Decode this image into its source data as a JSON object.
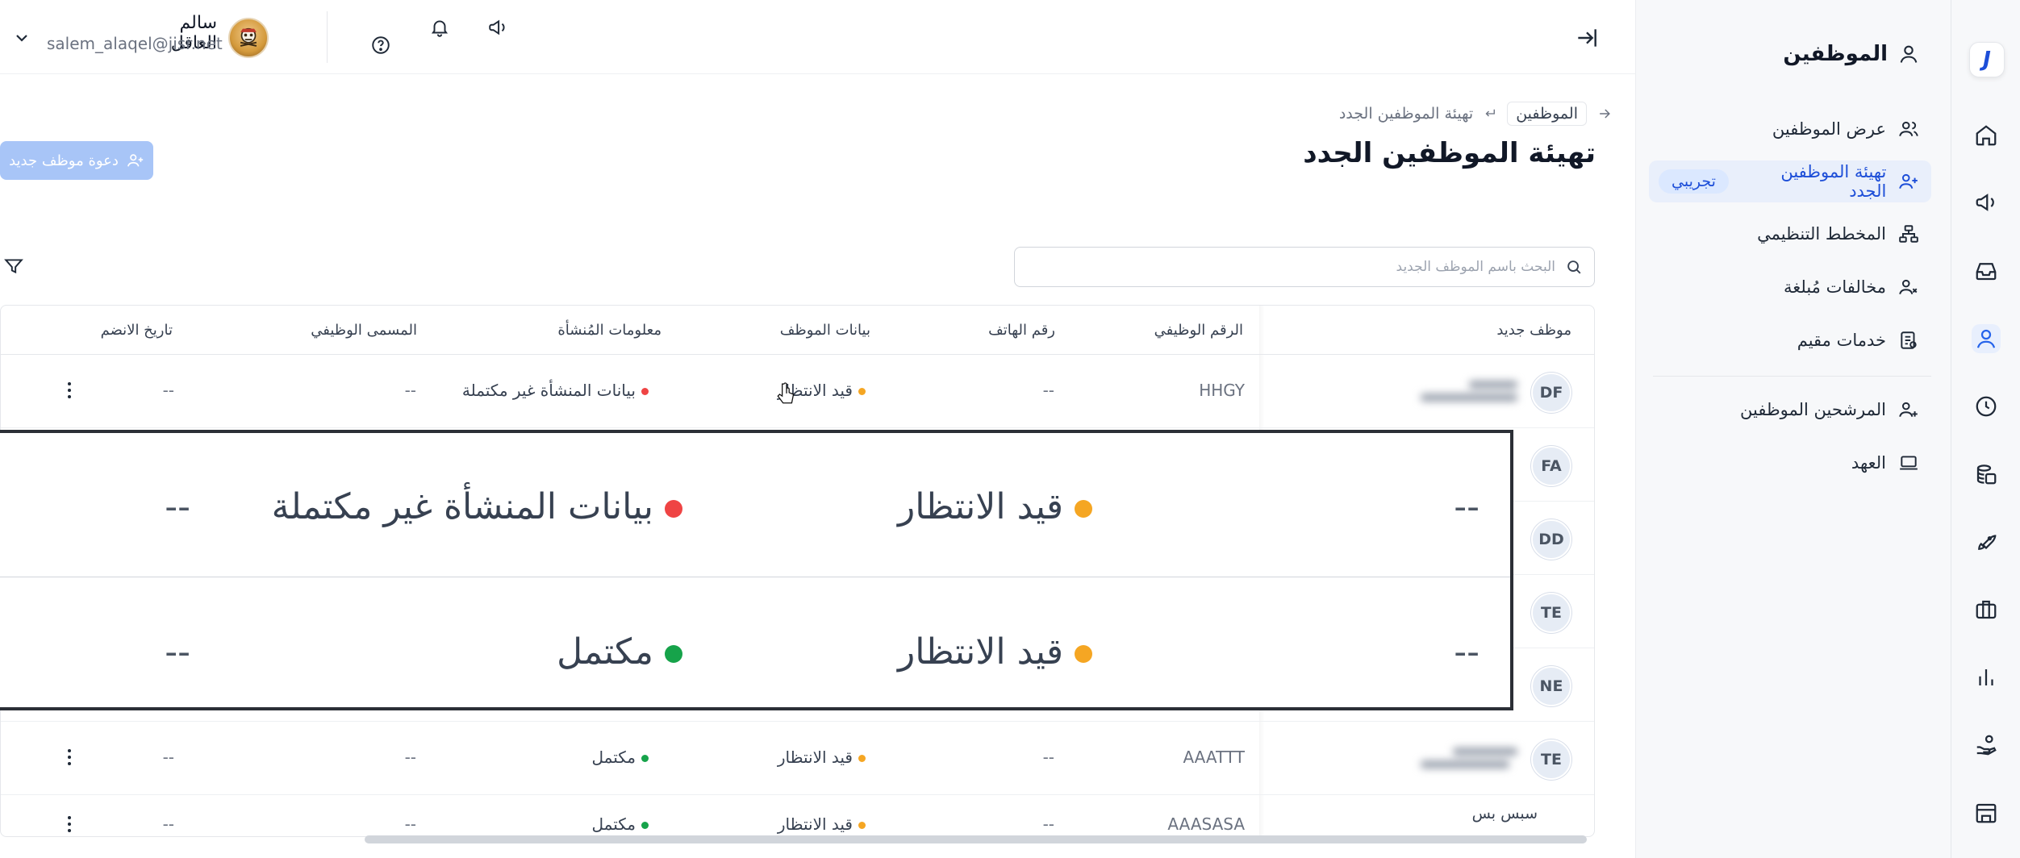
{
  "rail": {
    "icons": [
      "logo-icon",
      "home-icon",
      "megaphone-icon",
      "inbox-icon",
      "employees-icon",
      "clock-icon",
      "coins-icon",
      "rocket-icon",
      "briefcase-icon",
      "chart-icon",
      "hand-coin-icon",
      "building-icon"
    ],
    "logo_letter": "J",
    "accent": "#2563eb"
  },
  "side": {
    "title": "الموظفين",
    "items": [
      {
        "label": "عرض الموظفين",
        "icon": "users-icon"
      },
      {
        "label": "تهيئة الموظفين الجدد",
        "icon": "user-plus-icon",
        "badge": "تجريبي",
        "active": true
      },
      {
        "label": "المخطط التنظيمي",
        "icon": "org-chart-icon"
      },
      {
        "label": "مخالفات مُبلغة",
        "icon": "user-x-icon"
      },
      {
        "label": "خدمات مقيم",
        "icon": "document-icon"
      },
      {
        "label": "المرشحين الموظفين",
        "icon": "user-add-icon"
      },
      {
        "label": "العهد",
        "icon": "laptop-icon"
      }
    ]
  },
  "topbar": {
    "user_name": "سالم العاقل",
    "user_email": "salem_alaqel@jisr.net"
  },
  "header": {
    "breadcrumb_root": "الموظفين",
    "breadcrumb_current": "تهيئة الموظفين الجدد",
    "title": "تهيئة الموظفين الجدد",
    "invite_label": "دعوة موظف جديد"
  },
  "search": {
    "placeholder": "البحث باسم الموظف الجديد"
  },
  "table": {
    "columns": {
      "new_employee": "موظف جديد",
      "employee_id": "الرقم الوظيفي",
      "phone": "رقم الهاتف",
      "employee_data": "بيانات الموظف",
      "establishment_info": "معلومات المُنشأة",
      "job_title": "المسمى الوظيفي",
      "join_date": "تاريخ الانضم"
    },
    "rows": [
      {
        "initials": "DF",
        "employee_id": "HHGY",
        "phone": "--",
        "employee_status": "قيد الانتظار",
        "est_status": "بيانات المنشأة غير مكتملة",
        "est_color": "#ef4444",
        "job_title": "--",
        "join_date": "--"
      },
      {
        "initials": "FA",
        "employee_id": "",
        "phone": "",
        "employee_status": "",
        "est_status": "",
        "est_color": "",
        "job_title": "",
        "join_date": ""
      },
      {
        "initials": "DD",
        "employee_id": "",
        "phone": "",
        "employee_status": "",
        "est_status": "",
        "est_color": "",
        "job_title": "",
        "join_date": ""
      },
      {
        "initials": "TE",
        "employee_id": "",
        "phone": "",
        "employee_status": "",
        "est_status": "",
        "est_color": "",
        "job_title": "",
        "join_date": ""
      },
      {
        "initials": "NE",
        "employee_id": "",
        "phone": "",
        "employee_status": "",
        "est_status": "",
        "est_color": "",
        "job_title": "",
        "join_date": ""
      },
      {
        "initials": "TE",
        "employee_id": "AAATTT",
        "phone": "--",
        "employee_status": "قيد الانتظار",
        "est_status": "مكتمل",
        "est_color": "#16a34a",
        "job_title": "--",
        "join_date": "--"
      },
      {
        "initials": "",
        "name": "سبس بس",
        "employee_id": "AAASASA",
        "phone": "--",
        "employee_status": "قيد الانتظار",
        "est_status": "مكتمل",
        "est_color": "#16a34a",
        "job_title": "--",
        "join_date": "--"
      }
    ],
    "pending_color": "#f5a623"
  },
  "zoom": {
    "rows": [
      {
        "phone": "--",
        "employee_status": "قيد الانتظار",
        "est_status": "بيانات المنشأة غير مكتملة",
        "est_color": "#ef4444",
        "join_date": "--"
      },
      {
        "phone": "--",
        "employee_status": "قيد الانتظار",
        "est_status": "مكتمل",
        "est_color": "#16a34a",
        "join_date": "--"
      }
    ]
  }
}
